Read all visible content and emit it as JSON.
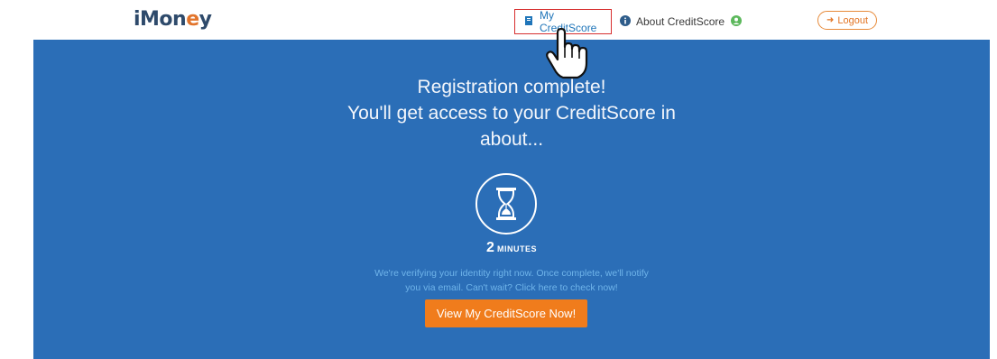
{
  "header": {
    "logo_text_1": "iMon",
    "logo_text_2": "e",
    "logo_text_3": "y",
    "nav": {
      "my_creditscore": "My CreditScore",
      "about_creditscore": "About CreditScore",
      "logout": "Logout"
    }
  },
  "hero": {
    "headline_line1": "Registration complete!",
    "headline_line2": "You'll get access to your CreditScore in",
    "headline_line3": "about...",
    "timer_value": "2",
    "timer_unit": "MINUTES",
    "note_line1": "We're verifying your identity right now. Once complete, we'll notify",
    "note_line2": "you via email. Can't wait? Click here to check now!",
    "cta_label": "View My CreditScore Now!"
  },
  "colors": {
    "hero_bg": "#2b6eb7",
    "cta_bg": "#f07c1c",
    "highlight_border": "#d72f2f"
  }
}
